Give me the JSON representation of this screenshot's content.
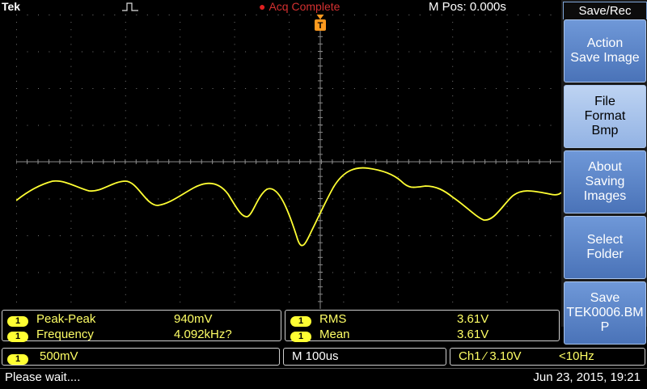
{
  "top_bar": {
    "brand": "Tek",
    "acq_status": "Acq Complete",
    "m_pos": "M Pos: 0.000s",
    "trigger_marker": "T"
  },
  "side_menu": {
    "title": "Save/Rec",
    "buttons": [
      {
        "lines": [
          "Action",
          "Save Image"
        ]
      },
      {
        "lines": [
          "File",
          "Format",
          "Bmp"
        ]
      },
      {
        "lines": [
          "About",
          "Saving",
          "Images"
        ]
      },
      {
        "lines": [
          "Select",
          "Folder"
        ]
      },
      {
        "lines": [
          "Save",
          "TEK0006.BM",
          "P"
        ]
      }
    ]
  },
  "measurements": {
    "left": [
      {
        "channel": "1",
        "name": "Peak-Peak",
        "value": "940mV"
      },
      {
        "channel": "1",
        "name": "Frequency",
        "value": "4.092kHz?"
      }
    ],
    "right": [
      {
        "channel": "1",
        "name": "RMS",
        "value": "3.61V"
      },
      {
        "channel": "1",
        "name": "Mean",
        "value": "3.61V"
      }
    ]
  },
  "status": {
    "channel": "1",
    "volts_div": "500mV",
    "timebase": "M 100us",
    "trigger": "Ch1 ⁄ 3.10V",
    "trigger_freq": "<10Hz"
  },
  "bottom": {
    "message": "Please wait....",
    "datetime": "Jun 23, 2015, 19:21"
  },
  "colors": {
    "trace": "#ffff33",
    "grid": "#9a9a9a",
    "menu": "#5b84c8"
  }
}
